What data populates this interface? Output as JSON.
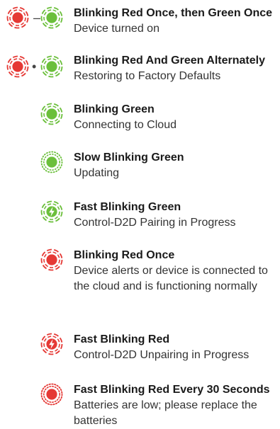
{
  "colors": {
    "red": "#e53935",
    "green": "#6bbf3b"
  },
  "items": [
    {
      "icons": [
        "red-ring-icon",
        "green-ring-icon"
      ],
      "separator": "–",
      "title": "Blinking Red Once, then Green Once",
      "description": "Device turned on"
    },
    {
      "icons": [
        "red-ring-icon",
        "green-ring-icon"
      ],
      "separator": "•",
      "title": "Blinking Red And Green Alternately",
      "description": "Restoring to Factory Defaults"
    },
    {
      "icons": [
        "green-ring-icon"
      ],
      "title": "Blinking Green",
      "description": "Connecting to Cloud"
    },
    {
      "icons": [
        "green-dotted-ring-icon"
      ],
      "title": "Slow Blinking Green",
      "description": "Updating"
    },
    {
      "icons": [
        "green-lightning-ring-icon"
      ],
      "title": "Fast Blinking Green",
      "description": "Control-D2D Pairing in Progress"
    },
    {
      "icons": [
        "red-ring-icon"
      ],
      "title": "Blinking Red Once",
      "description": "Device alerts or device is connected to the cloud and is functioning normally"
    },
    {
      "icons": [
        "red-lightning-ring-icon"
      ],
      "title": "Fast Blinking Red",
      "description": "Control-D2D Unpairing in Progress"
    },
    {
      "icons": [
        "red-dense-dotted-ring-icon"
      ],
      "title": "Fast Blinking Red Every 30 Seconds",
      "description": "Batteries are low; please replace the batteries"
    }
  ]
}
